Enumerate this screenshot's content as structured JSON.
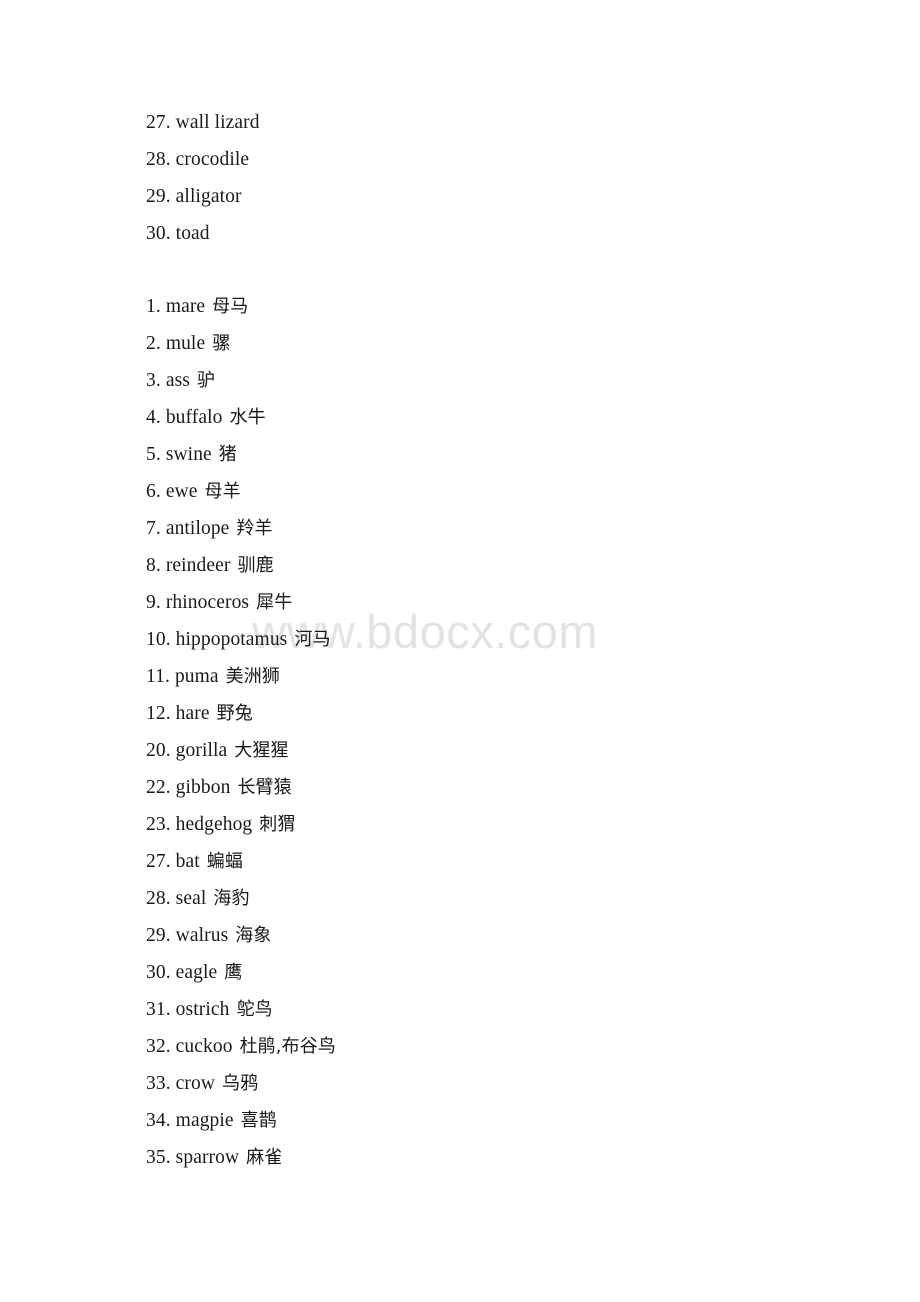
{
  "document": {
    "background_color": "#ffffff",
    "text_color": "#1a1a1a",
    "watermark": {
      "text": "www.bdocx.com",
      "color": "#e3e3e3"
    }
  },
  "blocks": [
    {
      "name": "reptiles-amphibians-list",
      "entries": [
        {
          "num": "27.",
          "term": "wall lizard",
          "gloss": ""
        },
        {
          "num": "28.",
          "term": "crocodile",
          "gloss": ""
        },
        {
          "num": "29.",
          "term": "alligator",
          "gloss": ""
        },
        {
          "num": "30.",
          "term": "toad",
          "gloss": ""
        }
      ]
    },
    {
      "name": "animals-bilingual-list",
      "entries": [
        {
          "num": "1.",
          "term": "mare",
          "gloss": "母马"
        },
        {
          "num": "2.",
          "term": "mule",
          "gloss": "骡"
        },
        {
          "num": "3.",
          "term": "ass",
          "gloss": "驴"
        },
        {
          "num": "4.",
          "term": "buffalo",
          "gloss": "水牛"
        },
        {
          "num": "5.",
          "term": "swine",
          "gloss": "猪"
        },
        {
          "num": "6.",
          "term": "ewe",
          "gloss": "母羊"
        },
        {
          "num": "7.",
          "term": "antilope",
          "gloss": "羚羊"
        },
        {
          "num": "8.",
          "term": "reindeer",
          "gloss": "驯鹿"
        },
        {
          "num": "9.",
          "term": "rhinoceros",
          "gloss": "犀牛"
        },
        {
          "num": "10.",
          "term": "hippopotamus",
          "gloss": "河马"
        },
        {
          "num": "11.",
          "term": "puma",
          "gloss": "美洲狮"
        },
        {
          "num": "12.",
          "term": "hare",
          "gloss": "野兔"
        },
        {
          "num": "20.",
          "term": "gorilla",
          "gloss": "大猩猩"
        },
        {
          "num": "22.",
          "term": "gibbon",
          "gloss": "长臂猿"
        },
        {
          "num": "23.",
          "term": "hedgehog",
          "gloss": "刺猬"
        },
        {
          "num": "27.",
          "term": "bat",
          "gloss": "蝙蝠"
        },
        {
          "num": "28.",
          "term": "seal",
          "gloss": "海豹"
        },
        {
          "num": "29.",
          "term": "walrus",
          "gloss": "海象"
        },
        {
          "num": "30.",
          "term": "eagle",
          "gloss": "鹰"
        },
        {
          "num": "31.",
          "term": "ostrich",
          "gloss": "鸵鸟"
        },
        {
          "num": "32.",
          "term": "cuckoo",
          "gloss": "杜鹃,布谷鸟"
        },
        {
          "num": "33.",
          "term": "crow",
          "gloss": "乌鸦"
        },
        {
          "num": "34.",
          "term": "magpie",
          "gloss": "喜鹊"
        },
        {
          "num": "35.",
          "term": "sparrow",
          "gloss": "麻雀"
        }
      ]
    }
  ]
}
